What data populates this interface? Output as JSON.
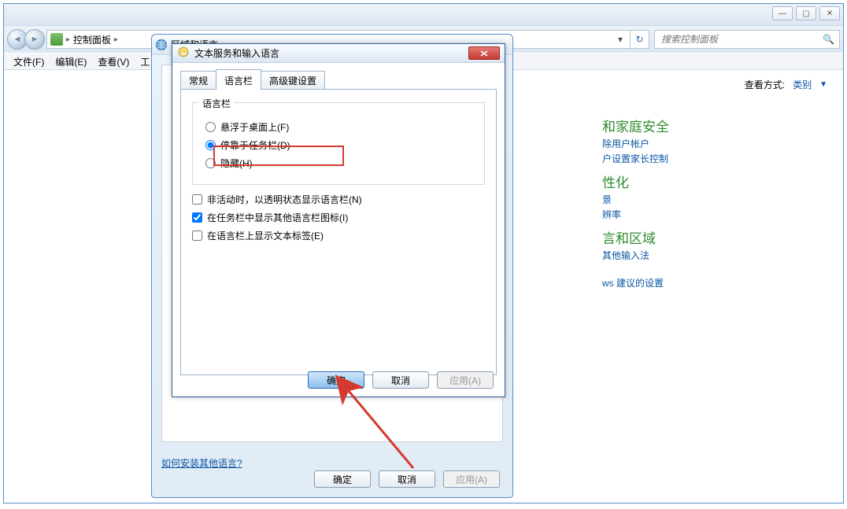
{
  "window": {
    "min": "—",
    "max": "▢",
    "close": "✕"
  },
  "breadcrumb": {
    "root": "控制面板",
    "sep": "▸",
    "refresh": "↻"
  },
  "search": {
    "placeholder": "搜索控制面板"
  },
  "menu": {
    "file": "文件(F)",
    "edit": "编辑(E)",
    "view": "查看(V)",
    "tools": "工"
  },
  "viewmode": {
    "label": "查看方式:",
    "value": "类别"
  },
  "cp": {
    "heading1": "和家庭安全",
    "link1a": "除用户帐户",
    "link1b": "户设置家长控制",
    "heading2": "性化",
    "link2a": "景",
    "link2b": "辨率",
    "heading3": "言和区域",
    "link3a": "其他输入法",
    "link4": "ws 建议的设置"
  },
  "region": {
    "title": "区域和语言",
    "help": "如何安装其他语言?",
    "ok": "确定",
    "cancel": "取消",
    "apply": "应用(A)"
  },
  "input": {
    "title": "文本服务和输入语言",
    "tabs": {
      "general": "常规",
      "langbar": "语言栏",
      "advanced": "高级键设置"
    },
    "group_legend": "语言栏",
    "radio1": "悬浮于桌面上(F)",
    "radio2": "停靠于任务栏(D)",
    "radio3": "隐藏(H)",
    "check1": "非活动时，以透明状态显示语言栏(N)",
    "check2": "在任务栏中显示其他语言栏图标(I)",
    "check3": "在语言栏上显示文本标签(E)",
    "ok": "确定",
    "cancel": "取消",
    "apply": "应用(A)"
  }
}
